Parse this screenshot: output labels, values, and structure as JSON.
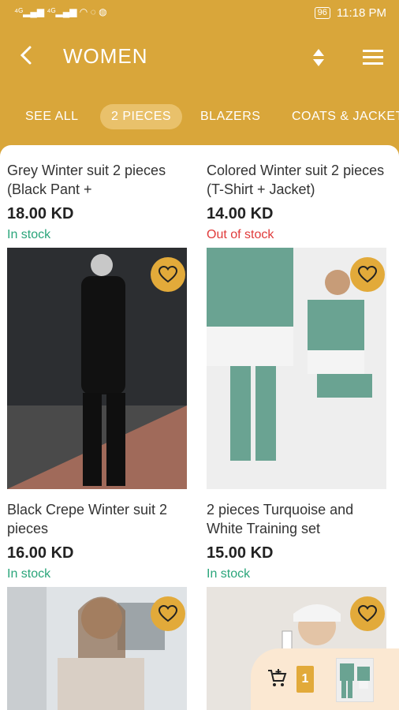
{
  "status": {
    "left": "⁴ᴳ▂▄▆ ⁴ᴳ▂▄▆ ◠ ◌ ◍",
    "battery": "96",
    "time": "11:18 PM"
  },
  "appbar": {
    "title": "WOMEN"
  },
  "tabs": [
    "SEE ALL",
    "2 PIECES",
    "BLAZERS",
    "COATS & JACKETS"
  ],
  "products": [
    {
      "title": "Grey Winter suit 2 pieces (Black Pant +",
      "price": "18.00 KD",
      "stock": "In stock"
    },
    {
      "title": "Colored Winter suit 2 pieces (T-Shirt + Jacket)",
      "price": "14.00 KD",
      "stock": "Out of stock"
    },
    {
      "title": "Black Crepe Winter suit 2 pieces",
      "price": "16.00 KD",
      "stock": "In stock"
    },
    {
      "title": "2 pieces Turquoise and White Training set",
      "price": "15.00 KD",
      "stock": "In stock"
    }
  ],
  "cart": {
    "count": "1"
  },
  "colors": {
    "accent": "#d9a63a",
    "in_stock": "#2aa57a",
    "out_of_stock": "#e03a3a"
  },
  "icons": [
    "back-arrow-icon",
    "sort-icon",
    "menu-icon",
    "heart-icon",
    "cart-add-icon"
  ]
}
